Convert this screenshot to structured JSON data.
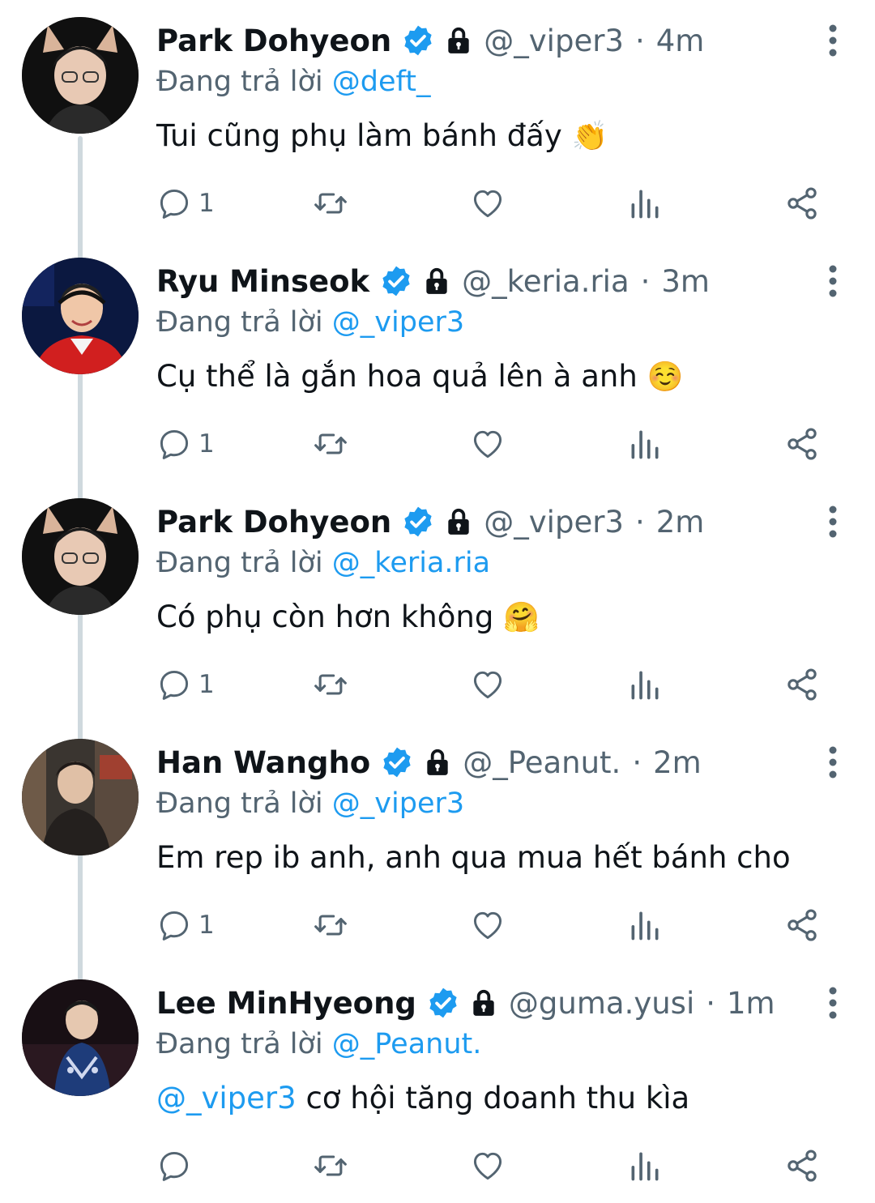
{
  "reply_prefix": "Đang trả lời",
  "colors": {
    "accent": "#1d9bf0",
    "text": "#0f1419",
    "muted": "#536471",
    "thread": "#cfd9de"
  },
  "tweets": [
    {
      "name": "Park Dohyeon",
      "handle": "@_viper3",
      "sep": "·",
      "time": "4m",
      "reply_to": "@deft_",
      "mention": "",
      "text": "Tui cũng phụ làm bánh đấy",
      "emoji": "👏",
      "reply_count": "1"
    },
    {
      "name": "Ryu Minseok",
      "handle": "@_keria.ria",
      "sep": "·",
      "time": "3m",
      "reply_to": "@_viper3",
      "mention": "",
      "text": "Cụ thể là gắn hoa quả lên à anh",
      "emoji": "☺️",
      "reply_count": "1"
    },
    {
      "name": "Park Dohyeon",
      "handle": "@_viper3",
      "sep": "·",
      "time": "2m",
      "reply_to": "@_keria.ria",
      "mention": "",
      "text": "Có phụ còn hơn không",
      "emoji": "🤗",
      "reply_count": "1"
    },
    {
      "name": "Han Wangho",
      "handle": "@_Peanut.",
      "sep": "·",
      "time": "2m",
      "reply_to": "@_viper3",
      "mention": "",
      "text": "Em rep ib anh, anh qua mua hết bánh cho",
      "emoji": "",
      "reply_count": "1"
    },
    {
      "name": "Lee MinHyeong",
      "handle": "@guma.yusi",
      "sep": "·",
      "time": "1m",
      "reply_to": "@_Peanut.",
      "mention": "@_viper3",
      "text": "cơ hội tăng doanh thu kìa",
      "emoji": "",
      "reply_count": ""
    }
  ]
}
